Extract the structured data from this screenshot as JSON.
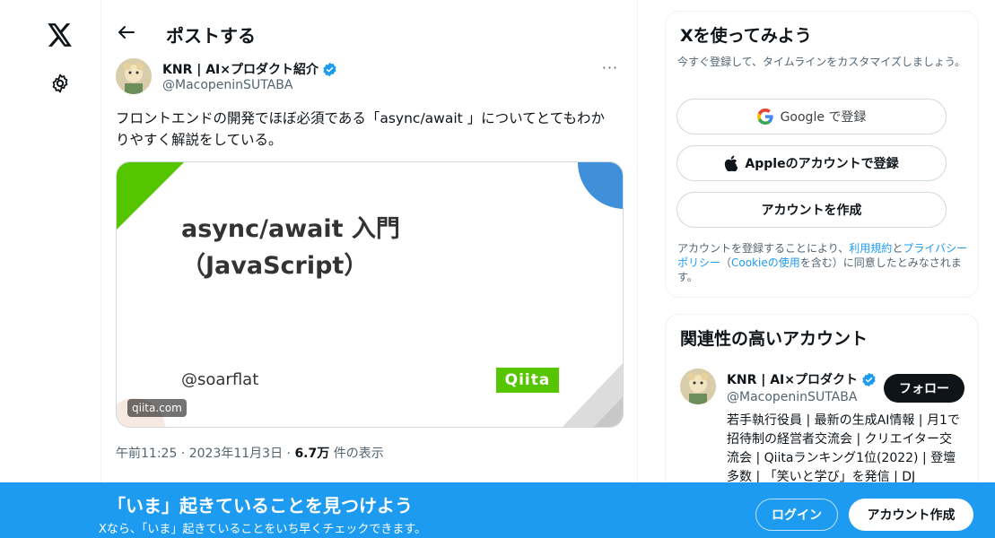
{
  "nav": {
    "logo_icon": "x-logo-icon",
    "settings_icon": "gear-icon"
  },
  "header": {
    "back_icon": "arrow-left-icon",
    "title": "ポストする"
  },
  "post": {
    "author_name": "KNR | AI×プロダクト紹介",
    "author_handle": "@MacopeninSUTABA",
    "verified_icon": "verified-badge-icon",
    "more_label": "···",
    "text": "フロントエンドの開発でほぼ必須である「async/await 」についてとてもわかりやすく解説をしている。",
    "card": {
      "title_line1": "async/await 入門",
      "title_line2": "（JavaScript）",
      "author": "@soarflat",
      "brand": "Qiita",
      "domain": "qiita.com",
      "accent_green": "#55c500",
      "accent_blue": "#3f8fd9"
    },
    "meta": {
      "time": "午前11:25",
      "separator": "·",
      "date": "2023年11月3日",
      "views": "6.7万",
      "views_label": "件の表示"
    }
  },
  "signup": {
    "title": "Xを使ってみよう",
    "subtitle": "今すぐ登録して、タイムラインをカスタマイズしましょう。",
    "google_label": "Google で登録",
    "apple_label": "Appleのアカウントで登録",
    "create_label": "アカウントを作成",
    "terms_prefix": "アカウントを登録することにより、",
    "terms_link": "利用規約",
    "terms_and": "と",
    "privacy_link": "プライバシーポリシー",
    "terms_paren_open": "（",
    "cookie_link": "Cookieの使用",
    "terms_suffix": "を含む）に同意したとみなされます。"
  },
  "related": {
    "title": "関連性の高いアカウント",
    "name": "KNR | AI×プロダクト",
    "handle": "@MacopeninSUTABA",
    "follow_label": "フォロー",
    "bio": "若手執行役員 | 最新の生成AI情報 | 月1で招待制の経営者交流会 | クリエイター交流会 | Qiitaランキング1位(2022) | 登壇多数 | 「笑いと学び」を発信 | DJ"
  },
  "banner": {
    "title": "「いま」起きていることを見つけよう",
    "subtitle": "Xなら、「いま」起きていることをいち早くチェックできます。",
    "login_label": "ログイン",
    "create_label": "アカウント作成",
    "background": "#1d9bf0"
  }
}
